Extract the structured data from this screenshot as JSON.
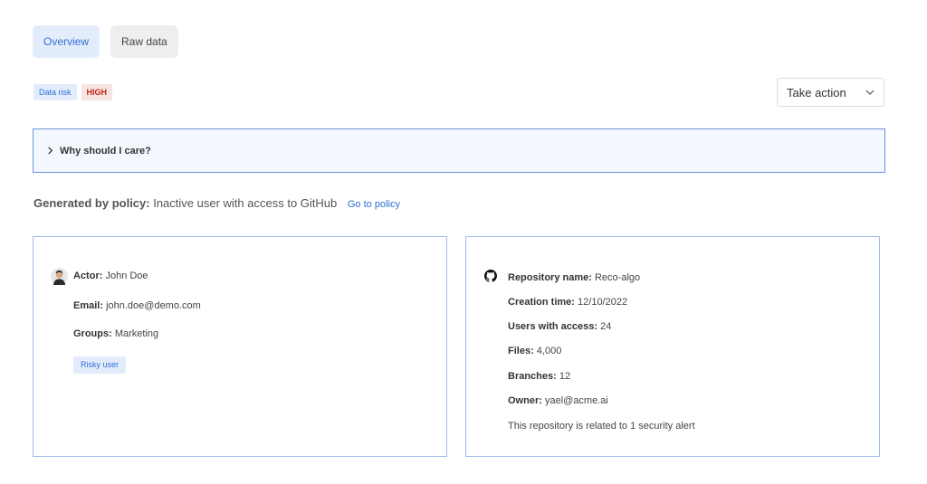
{
  "tabs": [
    {
      "label": "Overview"
    },
    {
      "label": "Raw data"
    }
  ],
  "badges": {
    "category": "Data risk",
    "severity": "HIGH"
  },
  "action_dropdown": {
    "label": "Take action",
    "icon": "chevron-down-icon"
  },
  "why_section": {
    "label": "Why should I care?",
    "icon": "chevron-right-icon"
  },
  "policy": {
    "key": "Generated by policy:",
    "value": "Inactive user with access to GitHub",
    "link": "Go to policy"
  },
  "actor_card": {
    "actor_key": "Actor:",
    "actor_value": "John Doe",
    "email_key": "Email:",
    "email_value": "john.doe@demo.com",
    "groups_key": "Groups:",
    "groups_value": "Marketing",
    "tag": "Risky user"
  },
  "repo_card": {
    "name_key": "Repository name:",
    "name_value": "Reco-algo",
    "created_key": "Creation time:",
    "created_value": "12/10/2022",
    "users_key": "Users with access:",
    "users_value": "24",
    "files_key": "Files:",
    "files_value": "4,000",
    "branches_key": "Branches:",
    "branches_value": "12",
    "owner_key": "Owner:",
    "owner_value": "yael@acme.ai",
    "alert_text": "This repository is related to 1 security alert"
  },
  "colors": {
    "accent": "#2f6fd6",
    "accent_bg": "#e3ecfb",
    "danger": "#c2271b",
    "card_border": "#9fbbee"
  }
}
